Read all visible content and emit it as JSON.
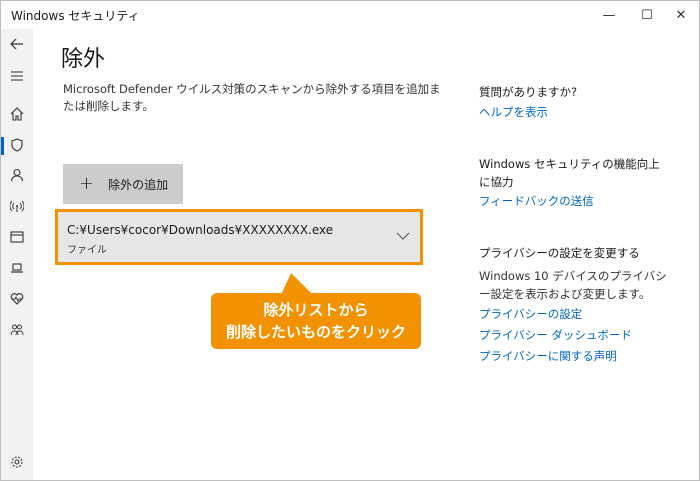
{
  "window": {
    "title": "Windows セキュリティ",
    "minimize": "—",
    "maximize": "☐",
    "close": "✕"
  },
  "rail": {
    "items": [
      {
        "icon": "back-arrow-icon"
      },
      {
        "icon": "hamburger-menu-icon"
      },
      {
        "icon": "home-icon"
      },
      {
        "icon": "shield-icon"
      },
      {
        "icon": "account-icon"
      },
      {
        "icon": "wifi-antenna-icon"
      },
      {
        "icon": "app-browser-icon"
      },
      {
        "icon": "device-laptop-icon"
      },
      {
        "icon": "health-heart-icon"
      },
      {
        "icon": "family-icon"
      },
      {
        "icon": "settings-gear-icon"
      }
    ]
  },
  "main": {
    "title": "除外",
    "description": "Microsoft Defender ウイルス対策のスキャンから除外する項目を追加または削除します。",
    "add_button": {
      "plus": "+",
      "label": "除外の追加"
    },
    "exclusion_item": {
      "path": "C:¥Users¥cocor¥Downloads¥XXXXXXXX.exe",
      "type": "ファイル"
    }
  },
  "callout": {
    "line1": "除外リストから",
    "line2": "削除したいものをクリック",
    "color": "#f39200"
  },
  "right": {
    "q_heading": "質問がありますか?",
    "help_link": "ヘルプを表示",
    "improve_heading": "Windows セキュリティの機能向上に協力",
    "feedback_link": "フィードバックの送信",
    "privacy_heading": "プライバシーの設定を変更する",
    "privacy_text": "Windows 10 デバイスのプライバシー設定を表示および変更します。",
    "privacy_settings_link": "プライバシーの設定",
    "privacy_dashboard_link": "プライバシー ダッシュボード",
    "privacy_statement_link": "プライバシーに関する声明"
  },
  "colors": {
    "accent": "#0067c0",
    "highlight_border": "#f39200",
    "button_bg": "#cccccc",
    "item_bg": "#e6e6e6"
  }
}
